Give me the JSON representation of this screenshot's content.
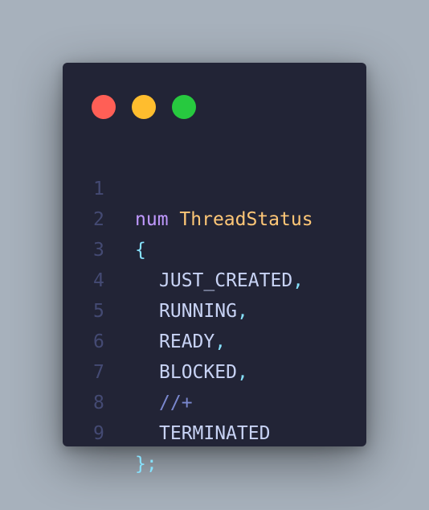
{
  "colors": {
    "background": "#a7b1bc",
    "editor": "#222436",
    "close": "#ff5f56",
    "minimize": "#ffbd2e",
    "zoom": "#27c93f",
    "line_number": "#444a73",
    "keyword": "#c099ff",
    "type_name": "#ffc777",
    "punctuation": "#86e1fc",
    "identifier": "#c8d3f5",
    "comment": "#7a88cf"
  },
  "window_controls": [
    "close",
    "minimize",
    "zoom"
  ],
  "code": {
    "lines": [
      {
        "number": "1",
        "tokens": [
          {
            "text": "num",
            "kind": "keyword"
          },
          {
            "text": " ",
            "kind": "space"
          },
          {
            "text": "ThreadStatus",
            "kind": "type_name"
          }
        ]
      },
      {
        "number": "2",
        "tokens": [
          {
            "text": "{",
            "kind": "punctuation"
          }
        ]
      },
      {
        "number": "3",
        "tokens": [
          {
            "text": "JUST_CREATED",
            "kind": "identifier"
          },
          {
            "text": ",",
            "kind": "punctuation"
          }
        ]
      },
      {
        "number": "4",
        "tokens": [
          {
            "text": "RUNNING",
            "kind": "identifier"
          },
          {
            "text": ",",
            "kind": "punctuation"
          }
        ]
      },
      {
        "number": "5",
        "tokens": [
          {
            "text": "READY",
            "kind": "identifier"
          },
          {
            "text": ",",
            "kind": "punctuation"
          }
        ]
      },
      {
        "number": "6",
        "tokens": [
          {
            "text": "BLOCKED",
            "kind": "identifier"
          },
          {
            "text": ",",
            "kind": "punctuation"
          }
        ]
      },
      {
        "number": "7",
        "tokens": [
          {
            "text": "//+",
            "kind": "comment"
          }
        ]
      },
      {
        "number": "8",
        "tokens": [
          {
            "text": "TERMINATED",
            "kind": "identifier"
          }
        ]
      },
      {
        "number": "9",
        "tokens": [
          {
            "text": "};",
            "kind": "punctuation"
          }
        ]
      }
    ]
  }
}
